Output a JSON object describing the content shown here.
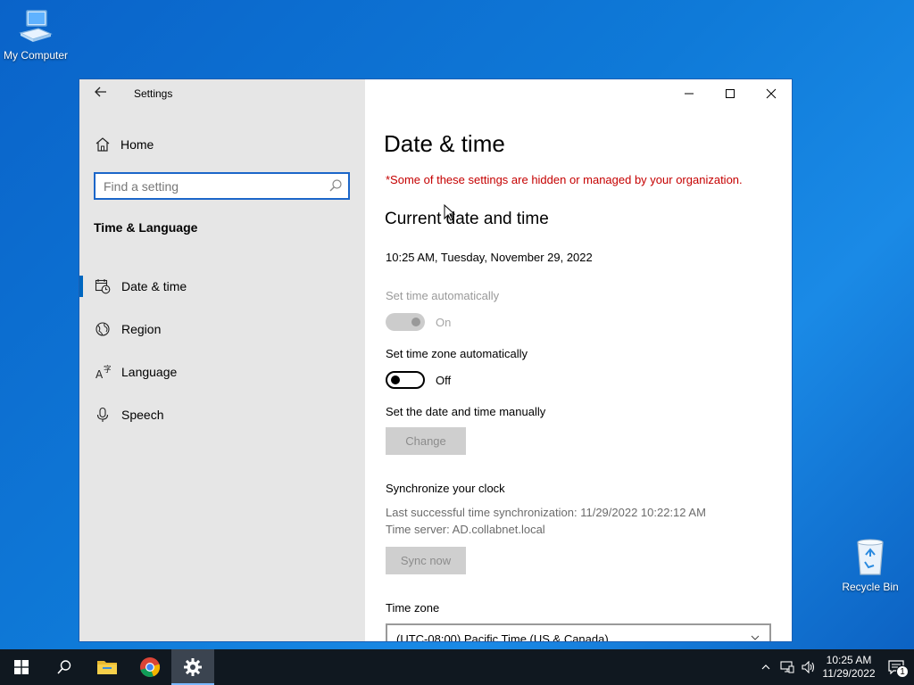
{
  "desktop": {
    "icons": [
      {
        "label": "My Computer",
        "icon": "computer-icon"
      },
      {
        "label": "Recycle Bin",
        "icon": "recycle-bin-icon"
      }
    ]
  },
  "window": {
    "app_title": "Settings",
    "back_icon": "back-arrow-icon",
    "controls": [
      "minimize-icon",
      "maximize-icon",
      "close-icon"
    ]
  },
  "sidebar": {
    "home_label": "Home",
    "search": {
      "placeholder": "Find a setting"
    },
    "section_title": "Time & Language",
    "items": [
      {
        "label": "Date & time",
        "icon": "calendar-clock-icon",
        "active": true
      },
      {
        "label": "Region",
        "icon": "globe-icon"
      },
      {
        "label": "Language",
        "icon": "language-icon"
      },
      {
        "label": "Speech",
        "icon": "microphone-icon"
      }
    ]
  },
  "main": {
    "title": "Date & time",
    "org_note": "*Some of these settings are hidden or managed by your organization.",
    "current_section": "Current date and time",
    "current_datetime": "10:25 AM, Tuesday, November 29, 2022",
    "set_time_auto": {
      "label": "Set time automatically",
      "state": "On"
    },
    "set_tz_auto": {
      "label": "Set time zone automatically",
      "state": "Off"
    },
    "manual": {
      "label": "Set the date and time manually",
      "button": "Change"
    },
    "sync": {
      "label": "Synchronize your clock",
      "last_sync": "Last successful time synchronization: 11/29/2022 10:22:12 AM",
      "server": "Time server: AD.collabnet.local",
      "button": "Sync now"
    },
    "timezone": {
      "label": "Time zone",
      "value": "(UTC-08:00) Pacific Time (US & Canada)"
    }
  },
  "taskbar": {
    "clock_time": "10:25 AM",
    "clock_date": "11/29/2022",
    "notification_count": "1",
    "accent": "#0067c0"
  }
}
